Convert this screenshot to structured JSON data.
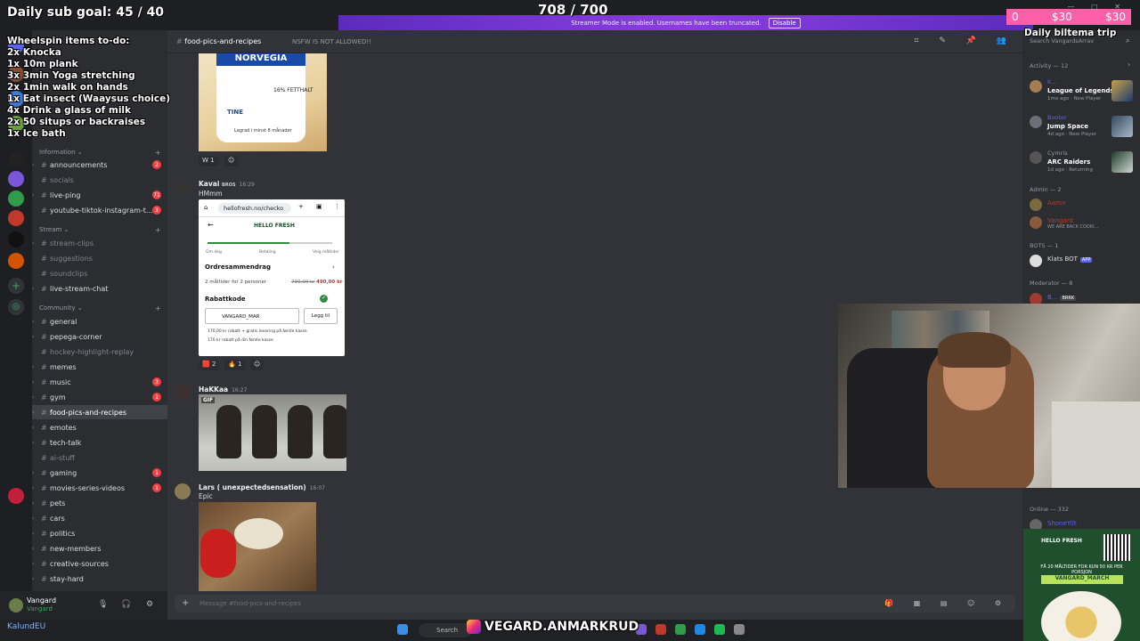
{
  "overlay": {
    "sub_goal": "Daily sub goal: 45 / 40",
    "counter": "708 / 700",
    "donation_left": "0",
    "donation_mid": "$30",
    "donation_right": "$30",
    "trip_title": "Daily biltema trip",
    "wheel_title": "Wheelspin items to-do:",
    "wheel_items": [
      "2x Knocka",
      "1x 10m plank",
      "3x 3min Yoga stretching",
      "2x 1min walk on hands",
      "1x Eat insect (Waaysus choice)",
      "4x Drink a glass of milk",
      "2x 50 situps or backraises",
      "1x Ice bath"
    ],
    "instagram": "VEGARD.ANMARKRUD"
  },
  "streamer_bar": {
    "text": "Streamer Mode is enabled. Usernames have been truncated.",
    "disable": "Disable"
  },
  "sidebar": {
    "categories": {
      "information": "Information",
      "stream": "Stream",
      "community": "Community"
    },
    "channels": [
      {
        "name": "announcements",
        "badge": "2"
      },
      {
        "name": "socials",
        "badge": ""
      },
      {
        "name": "live-ping",
        "badge": "71"
      },
      {
        "name": "youtube-tiktok-instagram-t...",
        "badge": "3"
      },
      {
        "name": "stream-clips",
        "badge": ""
      },
      {
        "name": "suggestions",
        "badge": ""
      },
      {
        "name": "soundclips",
        "badge": ""
      },
      {
        "name": "live-stream-chat",
        "badge": ""
      },
      {
        "name": "general",
        "badge": ""
      },
      {
        "name": "pepega-corner",
        "badge": ""
      },
      {
        "name": "hockey-highlight-replay",
        "badge": ""
      },
      {
        "name": "memes",
        "badge": ""
      },
      {
        "name": "music",
        "badge": "3"
      },
      {
        "name": "gym",
        "badge": "1"
      },
      {
        "name": "food-pics-and-recipes",
        "badge": ""
      },
      {
        "name": "emotes",
        "badge": ""
      },
      {
        "name": "tech-talk",
        "badge": ""
      },
      {
        "name": "ai-stuff",
        "badge": ""
      },
      {
        "name": "gaming",
        "badge": "1"
      },
      {
        "name": "movies-series-videos",
        "badge": "1"
      },
      {
        "name": "pets",
        "badge": ""
      },
      {
        "name": "cars",
        "badge": ""
      },
      {
        "name": "politics",
        "badge": ""
      },
      {
        "name": "new-members",
        "badge": ""
      },
      {
        "name": "creative-sources",
        "badge": ""
      },
      {
        "name": "stay-hard",
        "badge": ""
      }
    ]
  },
  "user": {
    "name": "Vangard",
    "status": "Vangard",
    "taskbar_user": "KalundEU"
  },
  "header": {
    "channel": "food-pics-and-recipes",
    "topic": "NSFW IS NOT ALLOWED!!"
  },
  "messages": {
    "cheese": {
      "brand": "NORVEGIA",
      "sub": "TINE",
      "pct": "16% FETTHALT",
      "note": "Lagrad i minst 8 månader",
      "reaction_count": "1"
    },
    "kavai": {
      "author": "Kavai",
      "tag": "BROS",
      "time": "16:29",
      "text": "HMmm"
    },
    "phone": {
      "url": "hellofresh.no/checko",
      "logo": "HELLO FRESH",
      "step1": "Om deg",
      "step2": "Betaling",
      "step3": "Velg måltider",
      "order_title": "Ordresammendrag",
      "order_line": "2 måltider for 2 personer",
      "price_old": "739,00 kr",
      "price_new": "490,00 kr",
      "rabatt": "Rabattkode",
      "code": "VANGARD_MAR",
      "apply": "Legg til",
      "disc1": "170,00 kr rabatt + gratis levering på første kasse",
      "disc2": "170 kr rabatt på din første kasse",
      "reaction1": "2",
      "reaction2": "1"
    },
    "hakkaa": {
      "author": "HaKKaa",
      "time": "16:27",
      "gif": "GIF"
    },
    "lars": {
      "author": "Lars ( unexpectedsensation)",
      "time": "16:07",
      "text": "Epic"
    }
  },
  "composer": {
    "placeholder": "Message #food-pics-and-recipes"
  },
  "members": {
    "search": "Search VangardsArrav",
    "activity_header": "Activity — 12",
    "activities": [
      {
        "name": "K...",
        "game": "League of Legends",
        "meta": "1mo ago · New Player"
      },
      {
        "name": "Booter",
        "game": "Jump Space",
        "meta": "4d ago · New Player"
      },
      {
        "name": "Cymris",
        "game": "ARC Raiders",
        "meta": "1d ago · Returning"
      }
    ],
    "admin_header": "Admin — 2",
    "admins": [
      {
        "name": "Aaron",
        "sub": ""
      },
      {
        "name": "Vangard",
        "sub": "WE ARE BACK COOKI..."
      }
    ],
    "bots_header": "BOTS — 1",
    "bot": {
      "name": "Klats BOT",
      "tag": "APP"
    },
    "mod_header": "Moderator — 8",
    "mod": {
      "name": "B...",
      "tag": "BRRK"
    },
    "online_header": "Online — 332",
    "online_first": "ShoneYilt"
  },
  "ad": {
    "brand": "HELLO FRESH",
    "line1": "FÅ 20 MÅLTIDER FOR KUN 50 KR PER PORSJON",
    "code": "VANGARD_MARCH"
  },
  "taskbar": {
    "search": "Search"
  }
}
